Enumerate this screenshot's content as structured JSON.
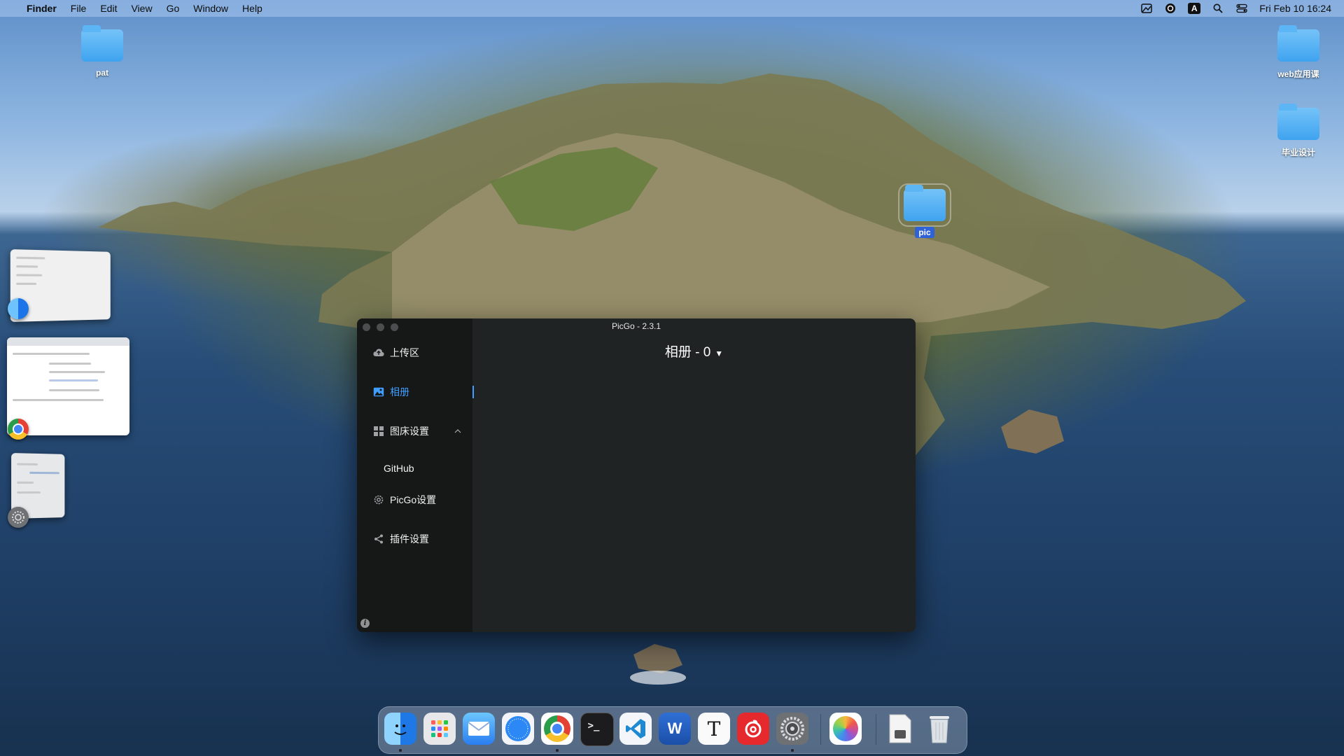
{
  "menubar": {
    "apple_glyph": "",
    "app_name": "Finder",
    "menus": [
      "File",
      "Edit",
      "View",
      "Go",
      "Window",
      "Help"
    ],
    "tray_input": "A",
    "clock": "Fri Feb 10  16:24"
  },
  "desktop_icons": {
    "pat": "pat",
    "web": "web应用课",
    "design": "毕业设计",
    "pic": "pic"
  },
  "picgo": {
    "window_title": "PicGo - 2.3.1",
    "nav": {
      "upload": "上传区",
      "album": "相册",
      "bed_settings": "图床设置",
      "github": "GitHub",
      "picgo_settings": "PicGo设置",
      "plugin_settings": "插件设置"
    },
    "album_header": "相册 - 0",
    "info_glyph": "i",
    "accent": "#409eff"
  },
  "dock": {
    "apps": [
      "finder-icon",
      "launchpad-icon",
      "mail-icon",
      "safari-icon",
      "chrome-icon",
      "terminal-icon",
      "vscode-icon",
      "word-icon",
      "typora-icon",
      "netease-music-icon",
      "system-preferences-icon",
      "photos-icon",
      "preview-document-icon",
      "trash-icon"
    ],
    "terminal_glyph": ">_",
    "word_glyph": "W",
    "typora_glyph": "T"
  }
}
